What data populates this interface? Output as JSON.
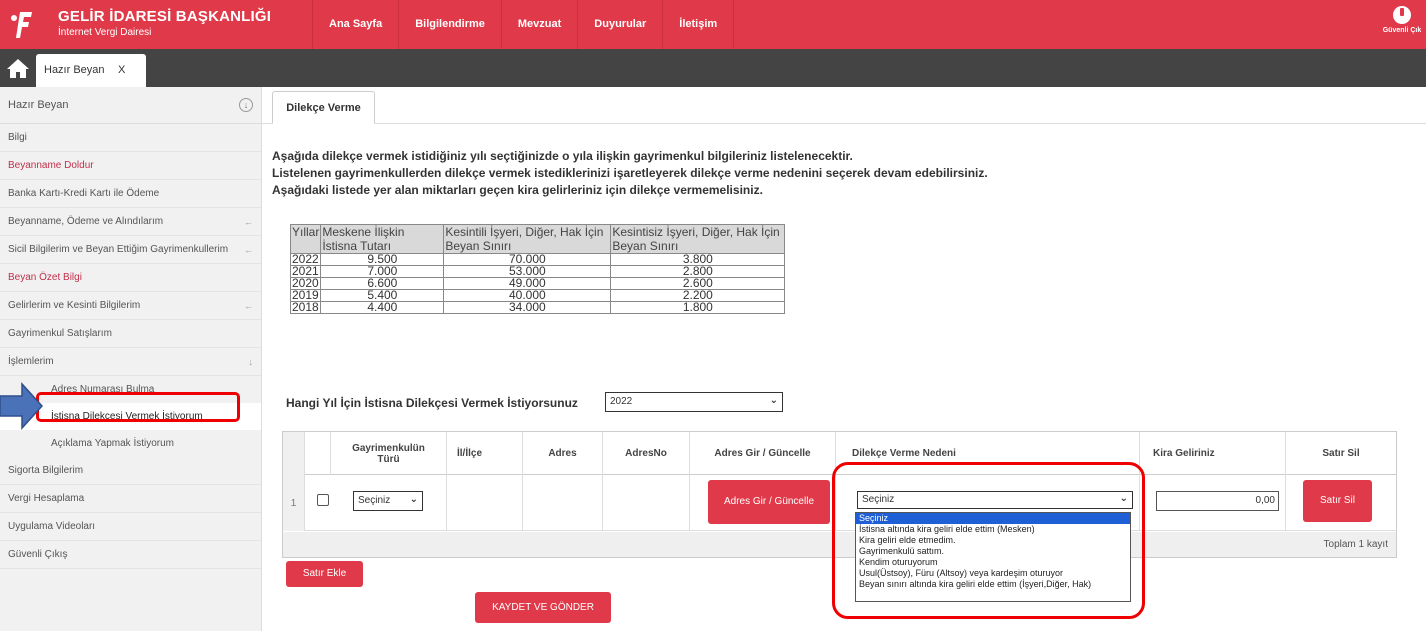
{
  "header": {
    "title": "GELİR İDARESİ BAŞKANLIĞI",
    "subtitle": "İnternet Vergi Dairesi",
    "nav": [
      "Ana Sayfa",
      "Bilgilendirme",
      "Mevzuat",
      "Duyurular",
      "İletişim"
    ],
    "exit_label": "Güvenli Çık",
    "brand_color": "#e03a4a"
  },
  "tabbar": {
    "home_icon": "home-icon",
    "tab_label": "Hazır Beyan",
    "close_label": "X"
  },
  "sidebar": {
    "head": "Hazır Beyan",
    "items": [
      {
        "label": "Bilgi"
      },
      {
        "label": "Beyanname Doldur"
      },
      {
        "label": "Banka Kartı-Kredi Kartı ile Ödeme"
      },
      {
        "label": "Beyanname, Ödeme ve Alındılarım"
      },
      {
        "label": "Sicil Bilgilerim ve Beyan Ettiğim Gayrimenkullerim"
      },
      {
        "label": "Beyan Özet Bilgi"
      },
      {
        "label": "Gelirlerim ve Kesinti Bilgilerim"
      },
      {
        "label": "Gayrimenkul Satışlarım"
      },
      {
        "label": "İşlemlerim"
      }
    ],
    "subitems": [
      "Adres Numarası Bulma",
      "İstisna Dilekçesi Vermek İstiyorum",
      "Açıklama Yapmak İstiyorum"
    ],
    "bottom_items": [
      "Sigorta Bilgilerim",
      "Vergi Hesaplama",
      "Uygulama Videoları",
      "Güvenli Çıkış"
    ]
  },
  "main": {
    "tab": "Dilekçe Verme",
    "intro": [
      "Aşağıda dilekçe vermek istidiğiniz yılı seçtiğinizde o yıla ilişkin gayrimenkul bilgileriniz listelenecektir.",
      "Listelenen gayrimenkullerden dilekçe vermek istediklerinizi işaretleyerek dilekçe verme nedenini seçerek devam edebilirsiniz.",
      "Aşağıdaki listede yer alan miktarları geçen kira gelirleriniz için dilekçe vermemelisiniz."
    ],
    "limits": {
      "headers": [
        "Yıllar",
        "Meskene İlişkin İstisna Tutarı",
        "Kesintili İşyeri, Diğer, Hak İçin Beyan Sınırı",
        "Kesintisiz İşyeri, Diğer, Hak İçin Beyan Sınırı"
      ],
      "rows": [
        [
          "2022",
          "9.500",
          "70.000",
          "3.800"
        ],
        [
          "2021",
          "7.000",
          "53.000",
          "2.800"
        ],
        [
          "2020",
          "6.600",
          "49.000",
          "2.600"
        ],
        [
          "2019",
          "5.400",
          "40.000",
          "2.200"
        ],
        [
          "2018",
          "4.400",
          "34.000",
          "1.800"
        ]
      ]
    },
    "question": "Hangi Yıl İçin İstisna Dilekçesi Vermek İstiyorsunuz",
    "year_selected": "2022",
    "grid": {
      "headers": [
        "Gayrimenkulün Türü",
        "İl/İlçe",
        "Adres",
        "AdresNo",
        "Adres Gir / Güncelle",
        "Dilekçe Verme Nedeni",
        "Kira Geliriniz",
        "Satır Sil"
      ],
      "row_num": "1",
      "type_value": "Seçiniz",
      "addr_button": "Adres Gir / Güncelle",
      "reason_value": "Seçiniz",
      "kira_value": "0,00",
      "delete_button": "Satır Sil",
      "total": "Toplam 1 kayıt"
    },
    "reason_options": [
      "Seçiniz",
      "İstisna altında kira geliri elde ettim (Mesken)",
      "Kira geliri elde etmedim.",
      "Gayrimenkulü sattım.",
      "Kendim oturuyorum",
      "Usul(Üstsoy), Füru (Altsoy) veya kardeşim oturuyor",
      "Beyan sınırı altında kira geliri elde ettim (İşyeri,Diğer, Hak)"
    ],
    "add_row_button": "Satır Ekle",
    "submit_button": "KAYDET VE GÖNDER"
  }
}
